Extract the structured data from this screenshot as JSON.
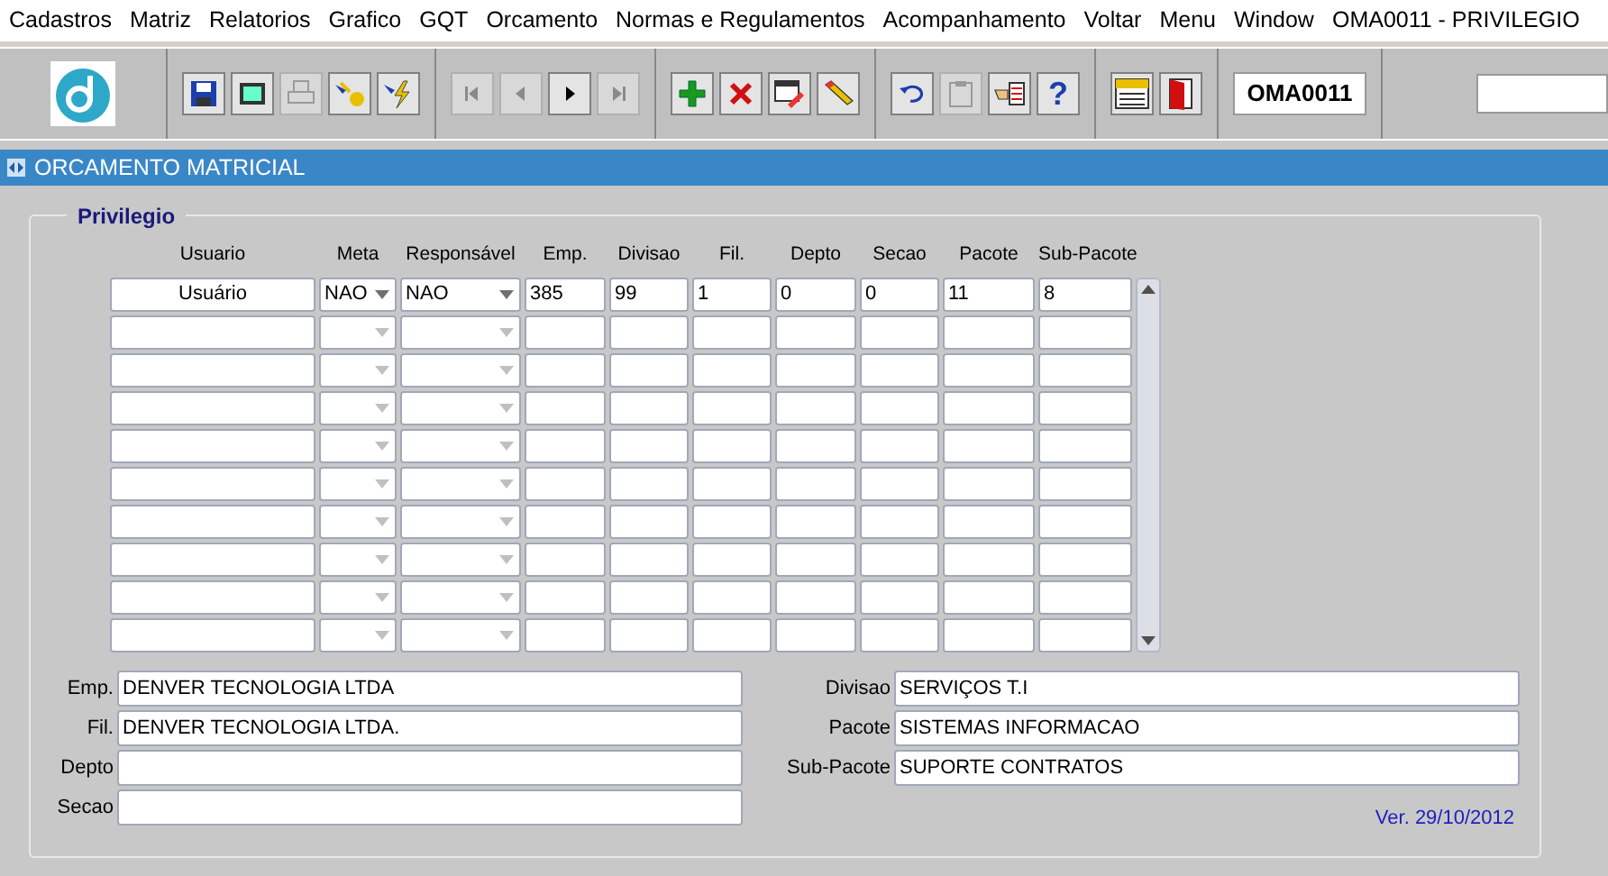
{
  "menu": [
    "Cadastros",
    "Matriz",
    "Relatorios",
    "Grafico",
    "GQT",
    "Orcamento",
    "Normas e Regulamentos",
    "Acompanhamento",
    "Voltar",
    "Menu",
    "Window",
    "OMA0011 - PRIVILEGIO"
  ],
  "toolbar": {
    "groups": [
      [
        {
          "kind": "save",
          "disabled": false
        },
        {
          "kind": "window",
          "disabled": false
        },
        {
          "kind": "print",
          "disabled": true
        },
        {
          "kind": "query",
          "disabled": false
        },
        {
          "kind": "execute",
          "disabled": false
        }
      ],
      [
        {
          "kind": "first",
          "disabled": true
        },
        {
          "kind": "prev",
          "disabled": true
        },
        {
          "kind": "next",
          "disabled": false
        },
        {
          "kind": "last",
          "disabled": true
        }
      ],
      [
        {
          "kind": "insert",
          "disabled": false
        },
        {
          "kind": "delete",
          "disabled": false
        },
        {
          "kind": "edit",
          "disabled": false
        },
        {
          "kind": "erase",
          "disabled": false
        }
      ],
      [
        {
          "kind": "undo",
          "disabled": false
        },
        {
          "kind": "clipboard",
          "disabled": true
        },
        {
          "kind": "list",
          "disabled": false
        },
        {
          "kind": "help",
          "glyph": "?",
          "disabled": false
        }
      ],
      [
        {
          "kind": "menu",
          "disabled": false
        },
        {
          "kind": "exit",
          "disabled": false
        }
      ]
    ],
    "form_code": "OMA0011"
  },
  "window": {
    "title": "ORCAMENTO MATRICIAL"
  },
  "section": {
    "title": "Privilegio"
  },
  "table": {
    "columns": [
      "Usuario",
      "Meta",
      "Responsável",
      "Emp.",
      "Divisao",
      "Fil.",
      "Depto",
      "Secao",
      "Pacote",
      "Sub-Pacote"
    ],
    "rows": [
      [
        "Usuário",
        "NAO",
        "NAO",
        "385",
        "99",
        "1",
        "0",
        "0",
        "11",
        "8"
      ],
      [],
      [],
      [],
      [],
      [],
      [],
      [],
      [],
      []
    ]
  },
  "details_left": [
    {
      "label": "Emp.",
      "value": "DENVER TECNOLOGIA LTDA"
    },
    {
      "label": "Fil.",
      "value": "DENVER TECNOLOGIA LTDA."
    },
    {
      "label": "Depto"
    },
    {
      "label": "Secao"
    }
  ],
  "details_right": [
    {
      "label": "Divisao",
      "value": "SERVIÇOS T.I"
    },
    {
      "label": "Pacote",
      "value": "SISTEMAS INFORMACAO"
    },
    {
      "label": "Sub-Pacote",
      "value": "SUPORTE CONTRATOS"
    }
  ],
  "version": "Ver. 29/10/2012"
}
